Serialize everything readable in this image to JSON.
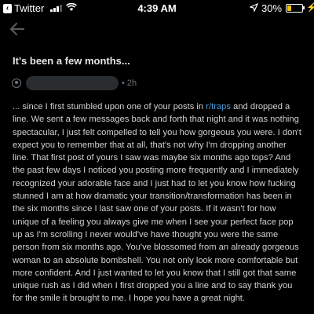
{
  "status_bar": {
    "back_app": "Twitter",
    "time": "4:39 AM",
    "battery_percent": "30%",
    "battery_level": 0.3,
    "battery_color": "#f5c400"
  },
  "header": {
    "back_icon": "back-arrow-icon"
  },
  "post": {
    "title": "It's been a few months...",
    "age": "• 2h",
    "body_part1": "... since I first stumbled upon one of your posts in ",
    "link": "r/traps",
    "body_part2": " and dropped a line. We sent a few messages back and forth that night and it was nothing spectacular, I just felt compelled to tell you how gorgeous you were. I don't expect you to remember that at all, that's not why I'm dropping another line. That first post of yours I saw was maybe six months ago tops? And the past few days I noticed you posting more frequently and I immediately recognized your adorable face and I just had to let you know how fucking stunned I am at how dramatic your transition/transformation has been in the six months since I last saw one of your posts. If it wasn't for how unique of a feeling you always give me when I see your perfect face pop up as I'm scrolling I never would've have thought you were the same person from six months ago. You've blossomed from an already gorgeous woman to an absolute bombshell. You not only look more comfortable but more confident. And I just wanted to let you know that I still got that same unique rush as I did when I first dropped you a line and to say thank you for the smile it brought to me. I hope you have a great night."
  },
  "colors": {
    "background": "#000000",
    "text": "#cfd2d4",
    "link": "#4f9bd6",
    "meta": "#6f7378"
  }
}
